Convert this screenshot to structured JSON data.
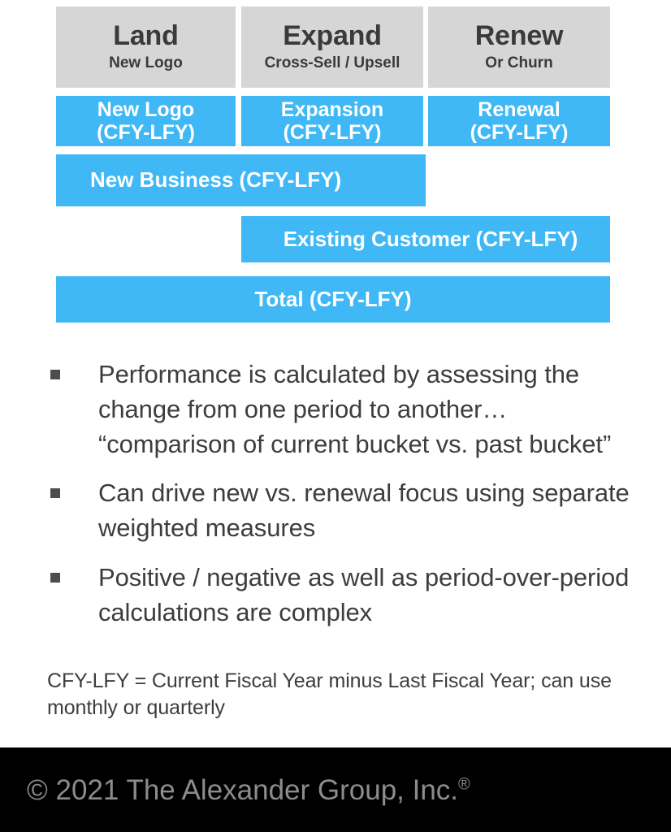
{
  "slide": {
    "stages": [
      {
        "title": "Land",
        "subtitle": "New Logo"
      },
      {
        "title": "Expand",
        "subtitle": "Cross-Sell / Upsell"
      },
      {
        "title": "Renew",
        "subtitle": "Or Churn"
      }
    ],
    "segment_bars": [
      {
        "line1": "New Logo",
        "line2": "(CFY-LFY)"
      },
      {
        "line1": "Expansion",
        "line2": "(CFY-LFY)"
      },
      {
        "line1": "Renewal",
        "line2": "(CFY-LFY)"
      }
    ],
    "rollup_bars": {
      "new_business": "New Business (CFY-LFY)",
      "existing_customer": "Existing Customer (CFY-LFY)",
      "total": "Total (CFY-LFY)"
    },
    "bullets": [
      "Performance is calculated by assessing the change from one period to another… “comparison of current bucket vs. past bucket”",
      "Can drive new vs. renewal focus using separate weighted measures",
      "Positive / negative as well as period-over-period calculations are complex"
    ],
    "footnote": "CFY-LFY = Current Fiscal Year minus Last Fiscal Year; can use monthly or quarterly"
  },
  "footer": {
    "copyright": "© 2021 The Alexander Group, Inc.",
    "registered_mark": "®"
  },
  "colors": {
    "bar_blue": "#3fb8f5",
    "header_gray": "#d6d6d6",
    "text_dark": "#3d3d3d",
    "footer_bg": "#000000",
    "footer_text": "#8c8c8c"
  }
}
